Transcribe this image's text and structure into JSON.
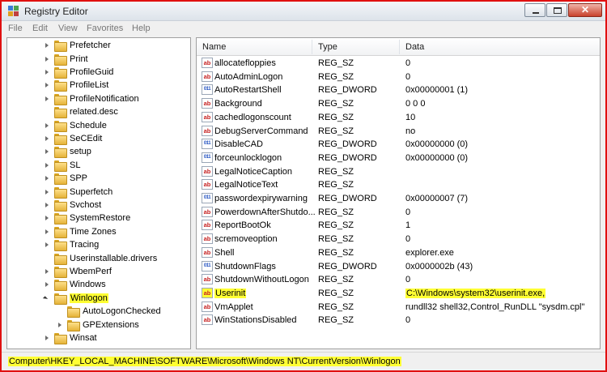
{
  "window": {
    "title": "Registry Editor"
  },
  "menu": [
    "File",
    "Edit",
    "View",
    "Favorites",
    "Help"
  ],
  "tree": [
    {
      "label": "Prefetcher",
      "state": "collapsed",
      "indent": 0
    },
    {
      "label": "Print",
      "state": "collapsed",
      "indent": 0
    },
    {
      "label": "ProfileGuid",
      "state": "collapsed",
      "indent": 0
    },
    {
      "label": "ProfileList",
      "state": "collapsed",
      "indent": 0
    },
    {
      "label": "ProfileNotification",
      "state": "collapsed",
      "indent": 0
    },
    {
      "label": "related.desc",
      "state": "none",
      "indent": 0
    },
    {
      "label": "Schedule",
      "state": "collapsed",
      "indent": 0
    },
    {
      "label": "SeCEdit",
      "state": "collapsed",
      "indent": 0
    },
    {
      "label": "setup",
      "state": "collapsed",
      "indent": 0
    },
    {
      "label": "SL",
      "state": "collapsed",
      "indent": 0
    },
    {
      "label": "SPP",
      "state": "collapsed",
      "indent": 0
    },
    {
      "label": "Superfetch",
      "state": "collapsed",
      "indent": 0
    },
    {
      "label": "Svchost",
      "state": "collapsed",
      "indent": 0
    },
    {
      "label": "SystemRestore",
      "state": "collapsed",
      "indent": 0
    },
    {
      "label": "Time Zones",
      "state": "collapsed",
      "indent": 0
    },
    {
      "label": "Tracing",
      "state": "collapsed",
      "indent": 0
    },
    {
      "label": "Userinstallable.drivers",
      "state": "none",
      "indent": 0
    },
    {
      "label": "WbemPerf",
      "state": "collapsed",
      "indent": 0
    },
    {
      "label": "Windows",
      "state": "collapsed",
      "indent": 0
    },
    {
      "label": "Winlogon",
      "state": "expanded",
      "indent": 0,
      "highlight": true
    },
    {
      "label": "AutoLogonChecked",
      "state": "none",
      "indent": 1
    },
    {
      "label": "GPExtensions",
      "state": "collapsed",
      "indent": 1
    },
    {
      "label": "Winsat",
      "state": "collapsed",
      "indent": 0
    }
  ],
  "columns": {
    "name": "Name",
    "type": "Type",
    "data": "Data"
  },
  "values": [
    {
      "icon": "ab",
      "name": "allocatefloppies",
      "type": "REG_SZ",
      "data": "0"
    },
    {
      "icon": "ab",
      "name": "AutoAdminLogon",
      "type": "REG_SZ",
      "data": "0"
    },
    {
      "icon": "dw",
      "name": "AutoRestartShell",
      "type": "REG_DWORD",
      "data": "0x00000001 (1)"
    },
    {
      "icon": "ab",
      "name": "Background",
      "type": "REG_SZ",
      "data": "0 0 0"
    },
    {
      "icon": "ab",
      "name": "cachedlogonscount",
      "type": "REG_SZ",
      "data": "10"
    },
    {
      "icon": "ab",
      "name": "DebugServerCommand",
      "type": "REG_SZ",
      "data": "no"
    },
    {
      "icon": "dw",
      "name": "DisableCAD",
      "type": "REG_DWORD",
      "data": "0x00000000 (0)"
    },
    {
      "icon": "dw",
      "name": "forceunlocklogon",
      "type": "REG_DWORD",
      "data": "0x00000000 (0)"
    },
    {
      "icon": "ab",
      "name": "LegalNoticeCaption",
      "type": "REG_SZ",
      "data": ""
    },
    {
      "icon": "ab",
      "name": "LegalNoticeText",
      "type": "REG_SZ",
      "data": ""
    },
    {
      "icon": "dw",
      "name": "passwordexpirywarning",
      "type": "REG_DWORD",
      "data": "0x00000007 (7)"
    },
    {
      "icon": "ab",
      "name": "PowerdownAfterShutdo...",
      "type": "REG_SZ",
      "data": "0"
    },
    {
      "icon": "ab",
      "name": "ReportBootOk",
      "type": "REG_SZ",
      "data": "1"
    },
    {
      "icon": "ab",
      "name": "scremoveoption",
      "type": "REG_SZ",
      "data": "0"
    },
    {
      "icon": "ab",
      "name": "Shell",
      "type": "REG_SZ",
      "data": "explorer.exe"
    },
    {
      "icon": "dw",
      "name": "ShutdownFlags",
      "type": "REG_DWORD",
      "data": "0x0000002b (43)"
    },
    {
      "icon": "ab",
      "name": "ShutdownWithoutLogon",
      "type": "REG_SZ",
      "data": "0"
    },
    {
      "icon": "ab",
      "name": "Userinit",
      "type": "REG_SZ",
      "data": "C:\\Windows\\system32\\userinit.exe,",
      "highlight": true
    },
    {
      "icon": "ab",
      "name": "VmApplet",
      "type": "REG_SZ",
      "data": "rundll32 shell32,Control_RunDLL \"sysdm.cpl\""
    },
    {
      "icon": "ab",
      "name": "WinStationsDisabled",
      "type": "REG_SZ",
      "data": "0"
    }
  ],
  "status": "Computer\\HKEY_LOCAL_MACHINE\\SOFTWARE\\Microsoft\\Windows NT\\CurrentVersion\\Winlogon",
  "colors": {
    "highlight": "#ffff33",
    "border": "#e01010"
  }
}
